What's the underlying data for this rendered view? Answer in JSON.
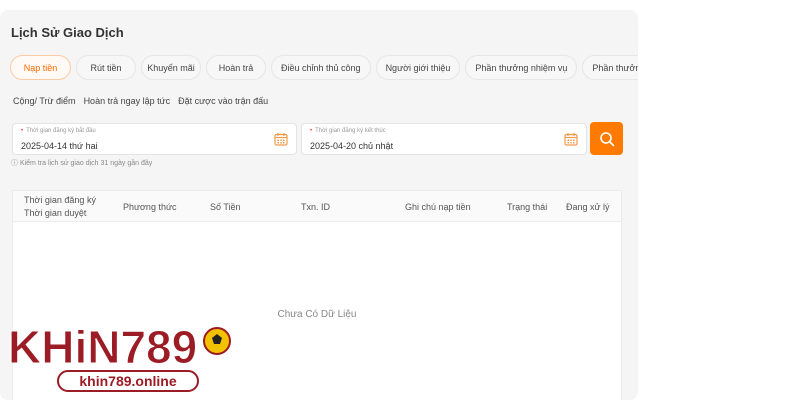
{
  "page": {
    "title": "Lịch Sử Giao Dịch"
  },
  "tabs_row1": [
    "Nạp tiền",
    "Rút tiền",
    "Khuyến mãi",
    "Hoàn trả",
    "Điều chỉnh thủ công",
    "Người giới thiệu",
    "Phần thưởng nhiệm vụ",
    "Phần thưởng hoạt động"
  ],
  "tabs_row2": [
    "Cộng/ Trừ điểm",
    "Hoàn trả ngay lập tức",
    "Đặt cược vào trận đấu"
  ],
  "active_tab": "Nạp tiền",
  "filters": {
    "start": {
      "label": "Thời gian đăng ký bắt đầu",
      "value": "2025-04-14 thứ hai"
    },
    "end": {
      "label": "Thời gian đăng ký kết thúc",
      "value": "2025-04-20 chủ nhật"
    },
    "required_mark": "•",
    "hint": "ⓘ Kiểm tra lịch sử giao dịch 31 ngày gần đây"
  },
  "table": {
    "columns": {
      "time_register": "Thời gian đăng ký",
      "time_approve": "Thời gian duyệt",
      "method": "Phương thức",
      "amount": "Số Tiền",
      "txn": "Txn. ID",
      "note": "Ghi chú nạp tiền",
      "status": "Trạng thái",
      "processing": "Đang xử lý"
    },
    "empty_text": "Chưa Có Dữ Liệu"
  },
  "logo": {
    "brand": "KHiN789",
    "domain": "khin789.online"
  },
  "colors": {
    "accent": "#ff7a00",
    "logo_red": "#9b1c24"
  }
}
